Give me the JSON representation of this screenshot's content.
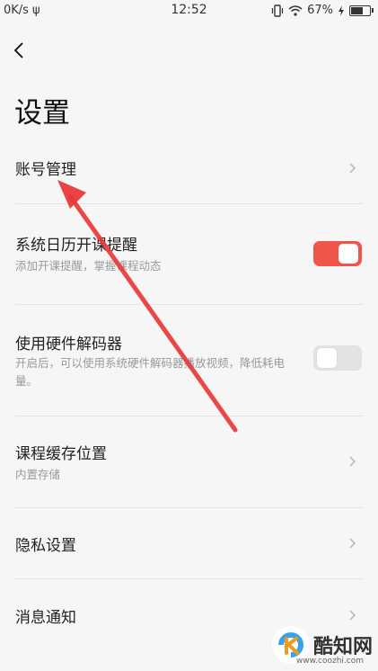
{
  "status_bar": {
    "network_speed": "0K/s",
    "usb_symbol": "ψ",
    "time": "12:52",
    "battery_percent": "67%",
    "battery_level": 0.67
  },
  "header": {
    "title": "设置"
  },
  "settings": {
    "account": {
      "title": "账号管理"
    },
    "calendar": {
      "title": "系统日历开课提醒",
      "subtitle": "添加开课提醒，掌握课程动态",
      "enabled": true
    },
    "hw_decoder": {
      "title": "使用硬件解码器",
      "subtitle": "开启后，可以使用系统硬件解码器播放视频，降低耗电量。",
      "enabled": false
    },
    "cache": {
      "title": "课程缓存位置",
      "subtitle": "内置存储"
    },
    "privacy": {
      "title": "隐私设置"
    },
    "notifications": {
      "title": "消息通知"
    }
  },
  "colors": {
    "accent": "#f0554c",
    "arrow": "#e8393a",
    "background": "#f6f6f6"
  },
  "watermark": {
    "name": "酷知网",
    "url": "www.coozhi.com"
  }
}
